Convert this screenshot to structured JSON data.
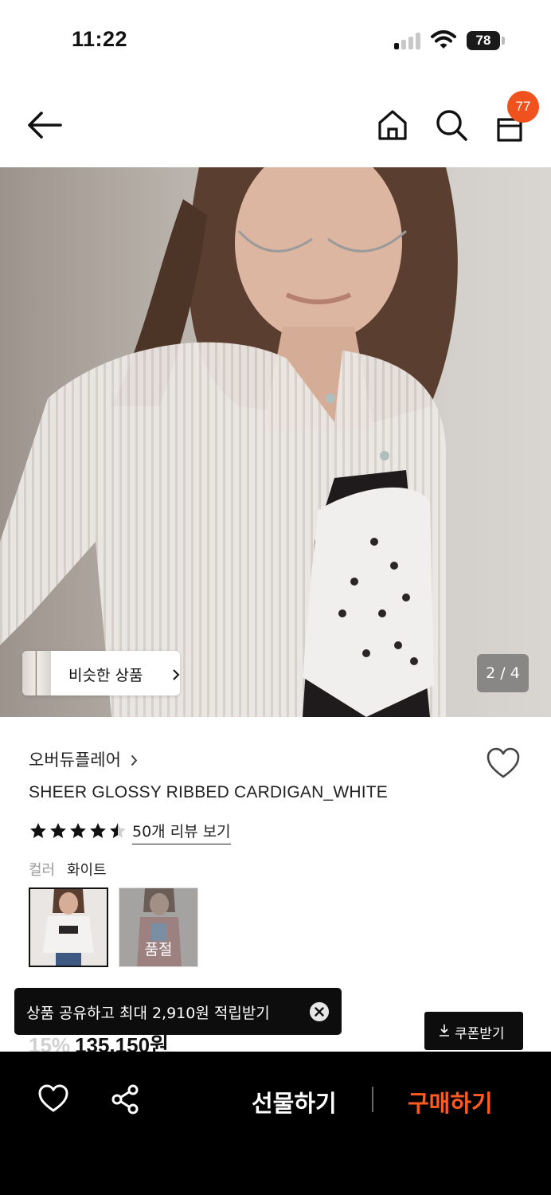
{
  "status_bar": {
    "time": "11:22",
    "battery": "78"
  },
  "header": {
    "cart_count": "77"
  },
  "gallery": {
    "similar_label": "비슷한 상품",
    "page_indicator": "2 / 4"
  },
  "product": {
    "brand": "오버듀플레어",
    "title": "SHEER GLOSSY RIBBED CARDIGAN_WHITE",
    "rating": 4.5,
    "review_link": "50개 리뷰 보기",
    "color_label": "컬러",
    "color_value": "화이트",
    "soldout_label": "품절",
    "discount": "15%",
    "price": "135,150원"
  },
  "toast": {
    "message": "상품 공유하고 최대 2,910원 적립받기"
  },
  "coupon": {
    "label": "쿠폰받기"
  },
  "bottom_bar": {
    "gift_label": "선물하기",
    "buy_label": "구매하기"
  },
  "colors": {
    "accent": "#f0521e",
    "buy": "#ff5a1f"
  },
  "icons": [
    "back-arrow-icon",
    "home-icon",
    "search-icon",
    "shopping-bag-icon",
    "heart-icon",
    "star-icon",
    "download-icon",
    "close-icon",
    "share-icon",
    "chevron-right-icon"
  ]
}
